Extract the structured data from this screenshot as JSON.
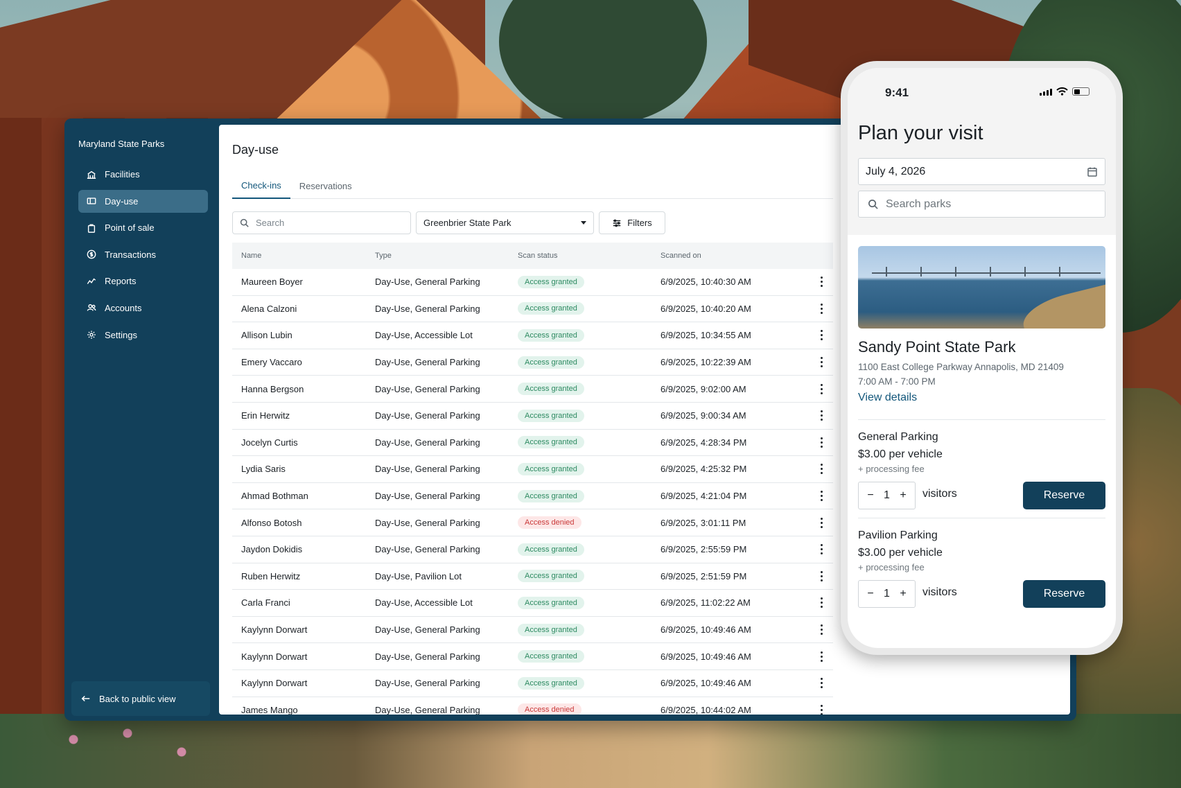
{
  "admin": {
    "brand": "Maryland State Parks",
    "nav": [
      {
        "label": "Facilities",
        "icon": "building-icon"
      },
      {
        "label": "Day-use",
        "icon": "ticket-icon",
        "active": true
      },
      {
        "label": "Point of sale",
        "icon": "bag-icon"
      },
      {
        "label": "Transactions",
        "icon": "dollar-circle-icon"
      },
      {
        "label": "Reports",
        "icon": "chart-icon"
      },
      {
        "label": "Accounts",
        "icon": "users-icon"
      },
      {
        "label": "Settings",
        "icon": "gear-icon"
      }
    ],
    "back_label": "Back to public view",
    "page_title": "Day-use",
    "tabs": [
      {
        "label": "Check-ins",
        "active": true
      },
      {
        "label": "Reservations"
      }
    ],
    "search_placeholder": "Search",
    "park_select": "Greenbrier State Park",
    "filters_label": "Filters",
    "columns": [
      "Name",
      "Type",
      "Scan status",
      "Scanned on"
    ],
    "rows": [
      {
        "name": "Maureen Boyer",
        "type": "Day-Use, General Parking",
        "status": "Access granted",
        "date": "6/9/2025, 10:40:30 AM"
      },
      {
        "name": "Alena Calzoni",
        "type": "Day-Use, General Parking",
        "status": "Access granted",
        "date": "6/9/2025, 10:40:20 AM"
      },
      {
        "name": "Allison Lubin",
        "type": "Day-Use, Accessible Lot",
        "status": "Access granted",
        "date": "6/9/2025, 10:34:55 AM"
      },
      {
        "name": "Emery Vaccaro",
        "type": "Day-Use, General Parking",
        "status": "Access granted",
        "date": "6/9/2025, 10:22:39 AM"
      },
      {
        "name": "Hanna Bergson",
        "type": "Day-Use, General Parking",
        "status": "Access granted",
        "date": "6/9/2025, 9:02:00 AM"
      },
      {
        "name": "Erin Herwitz",
        "type": "Day-Use, General Parking",
        "status": "Access granted",
        "date": "6/9/2025, 9:00:34 AM"
      },
      {
        "name": "Jocelyn Curtis",
        "type": "Day-Use, General Parking",
        "status": "Access granted",
        "date": "6/9/2025, 4:28:34 PM"
      },
      {
        "name": "Lydia Saris",
        "type": "Day-Use, General Parking",
        "status": "Access granted",
        "date": "6/9/2025, 4:25:32 PM"
      },
      {
        "name": "Ahmad Bothman",
        "type": "Day-Use, General Parking",
        "status": "Access granted",
        "date": "6/9/2025, 4:21:04 PM"
      },
      {
        "name": "Alfonso Botosh",
        "type": "Day-Use, General Parking",
        "status": "Access denied",
        "date": "6/9/2025, 3:01:11 PM"
      },
      {
        "name": "Jaydon Dokidis",
        "type": "Day-Use, General Parking",
        "status": "Access granted",
        "date": "6/9/2025, 2:55:59 PM"
      },
      {
        "name": "Ruben Herwitz",
        "type": "Day-Use, Pavilion Lot",
        "status": "Access granted",
        "date": "6/9/2025, 2:51:59 PM"
      },
      {
        "name": "Carla Franci",
        "type": "Day-Use, Accessible Lot",
        "status": "Access granted",
        "date": "6/9/2025, 11:02:22 AM"
      },
      {
        "name": "Kaylynn Dorwart",
        "type": "Day-Use, General Parking",
        "status": "Access granted",
        "date": "6/9/2025, 10:49:46 AM"
      },
      {
        "name": "Kaylynn Dorwart",
        "type": "Day-Use, General Parking",
        "status": "Access granted",
        "date": "6/9/2025, 10:49:46 AM"
      },
      {
        "name": "Kaylynn Dorwart",
        "type": "Day-Use, General Parking",
        "status": "Access granted",
        "date": "6/9/2025, 10:49:46 AM"
      },
      {
        "name": "James Mango",
        "type": "Day-Use, General Parking",
        "status": "Access denied",
        "date": "6/9/2025, 10:44:02 AM"
      }
    ]
  },
  "phone": {
    "time": "9:41",
    "title": "Plan your visit",
    "date_value": "July 4, 2026",
    "search_placeholder": "Search parks",
    "park": {
      "name": "Sandy Point State Park",
      "address": "1100 East College Parkway Annapolis, MD 21409",
      "hours": "7:00 AM - 7:00 PM",
      "link": "View details"
    },
    "options": [
      {
        "title": "General Parking",
        "price": "$3.00 per vehicle",
        "fee": "+ processing fee",
        "qty": "1",
        "unit": "visitors",
        "button": "Reserve"
      },
      {
        "title": "Pavilion Parking",
        "price": "$3.00 per vehicle",
        "fee": "+ processing fee",
        "qty": "1",
        "unit": "visitors",
        "button": "Reserve"
      }
    ],
    "minus": "−",
    "plus": "+"
  },
  "colors": {
    "brand": "#12405a",
    "nav_active": "#3b6d88",
    "link": "#12567a",
    "granted_bg": "#e2f3ec",
    "granted_text": "#2d8a61",
    "denied_bg": "#fde7e7",
    "denied_text": "#c93838"
  }
}
